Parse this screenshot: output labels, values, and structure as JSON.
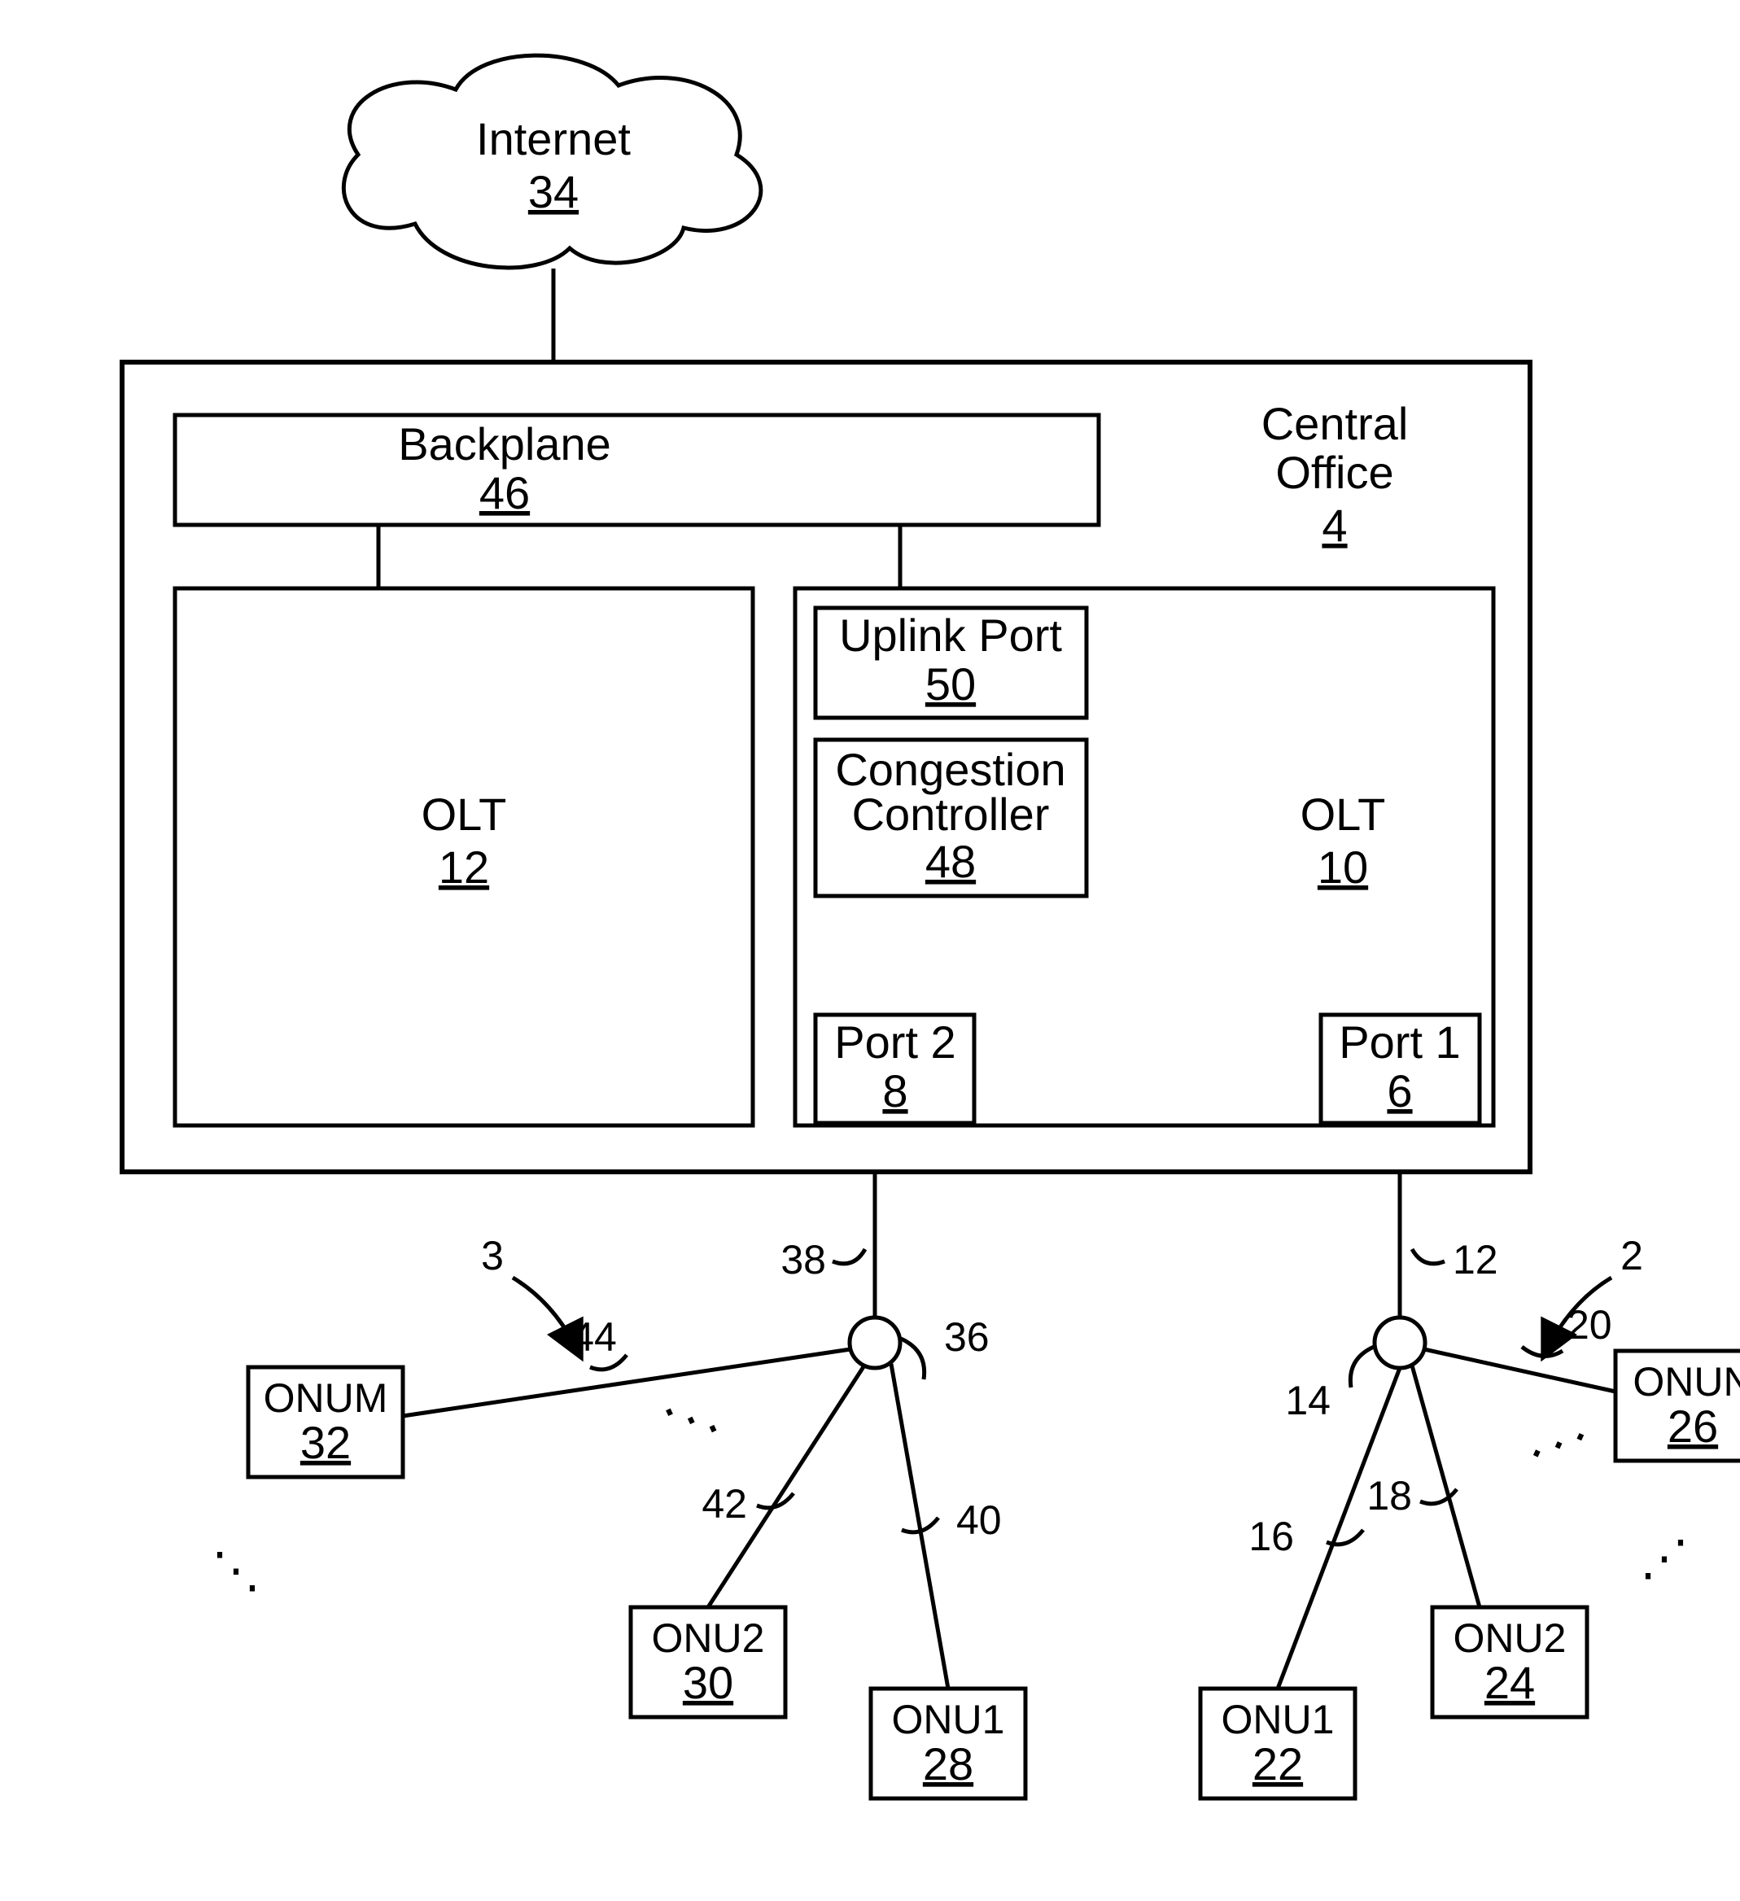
{
  "internet": {
    "label": "Internet",
    "num": "34"
  },
  "central_office": {
    "label_line1": "Central",
    "label_line2": "Office",
    "num": "4"
  },
  "backplane": {
    "label": "Backplane",
    "num": "46"
  },
  "olt_left": {
    "label": "OLT",
    "num": "12"
  },
  "olt_right": {
    "label": "OLT",
    "num": "10"
  },
  "uplink": {
    "label": "Uplink Port",
    "num": "50"
  },
  "congestion": {
    "label_line1": "Congestion",
    "label_line2": "Controller",
    "num": "48"
  },
  "port2": {
    "label": "Port 2",
    "num": "8"
  },
  "port1": {
    "label": "Port 1",
    "num": "6"
  },
  "splitter_left": {
    "num": "36"
  },
  "splitter_right": {
    "num": "14"
  },
  "group_left": {
    "num": "3"
  },
  "group_right": {
    "num": "2"
  },
  "fiber_port2": "38",
  "fiber_port1": "12",
  "fiber_r16": "16",
  "fiber_r18": "18",
  "fiber_r20": "20",
  "fiber_l40": "40",
  "fiber_l42": "42",
  "fiber_l44": "44",
  "onu_l_m": {
    "label": "ONUM",
    "num": "32"
  },
  "onu_l_2": {
    "label": "ONU2",
    "num": "30"
  },
  "onu_l_1": {
    "label": "ONU1",
    "num": "28"
  },
  "onu_r_1": {
    "label": "ONU1",
    "num": "22"
  },
  "onu_r_2": {
    "label": "ONU2",
    "num": "24"
  },
  "onu_r_n": {
    "label": "ONUN",
    "num": "26"
  }
}
